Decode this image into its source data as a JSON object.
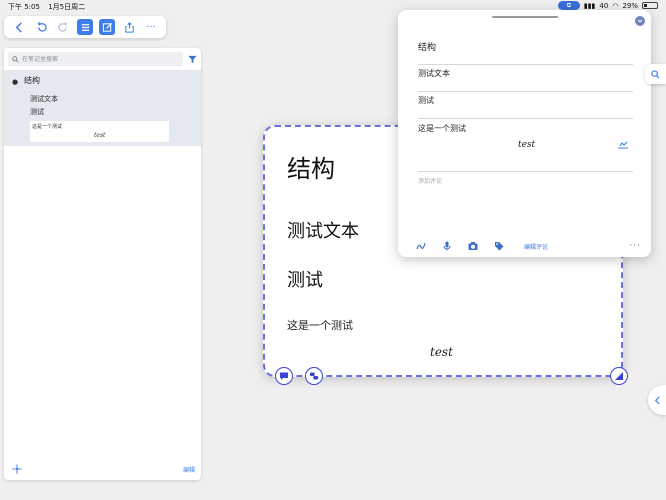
{
  "statusbar": {
    "time": "下午 5:05",
    "date": "1月5日周二",
    "signal": "40",
    "battery": "29%",
    "battery_level": 0.29
  },
  "toolbar": {
    "back_icon": "chevron-left-icon",
    "undo_icon": "undo-icon",
    "redo_icon": "redo-icon",
    "outline_icon": "list-icon",
    "edit_icon": "edit-icon",
    "share_icon": "share-icon",
    "more_icon": "more-icon",
    "more_label": "···"
  },
  "sidebar": {
    "search_placeholder": "在笔记里搜索",
    "outline": {
      "title": "结构",
      "items": [
        "测试文本",
        "测试"
      ],
      "card_text": "这是一个测试",
      "card_math": "test"
    },
    "edit_label": "编辑"
  },
  "canvas_card": {
    "title": "结构",
    "sub1": "测试文本",
    "sub2": "测试",
    "text": "这是一个测试",
    "math": "test"
  },
  "popup": {
    "field1": "结构",
    "field2": "测试文本",
    "field3": "测试",
    "field4_text": "这是一个测试",
    "field4_math": "test",
    "comment_placeholder": "添加评论",
    "edit_comment_label": "编辑评论",
    "more_label": "···"
  },
  "colors": {
    "accent": "#3f7ee8",
    "card_border": "#6b72e0",
    "selection": "#e4e8ef"
  }
}
